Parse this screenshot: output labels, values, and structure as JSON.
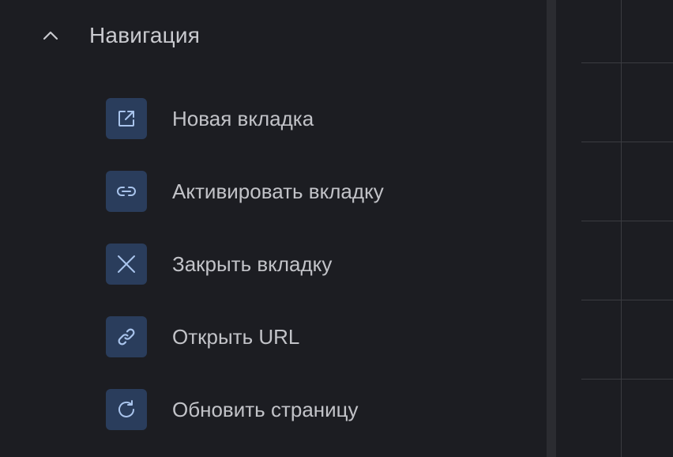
{
  "section": {
    "title": "Навигация",
    "icon": "chevron-up-icon",
    "expanded": true
  },
  "items": [
    {
      "label": "Новая вкладка",
      "icon": "external-link-icon"
    },
    {
      "label": "Активировать вкладку",
      "icon": "link-icon"
    },
    {
      "label": "Закрыть вкладку",
      "icon": "close-icon"
    },
    {
      "label": "Открыть URL",
      "icon": "chain-link-icon"
    },
    {
      "label": "Обновить страницу",
      "icon": "refresh-icon"
    }
  ],
  "colors": {
    "background": "#1c1d22",
    "divider": "#2b2c31",
    "icon_tile": "#2a3d5c",
    "icon_stroke": "#a9c4ec",
    "text": "#c2c3c8",
    "grid": "#3a3b40"
  }
}
